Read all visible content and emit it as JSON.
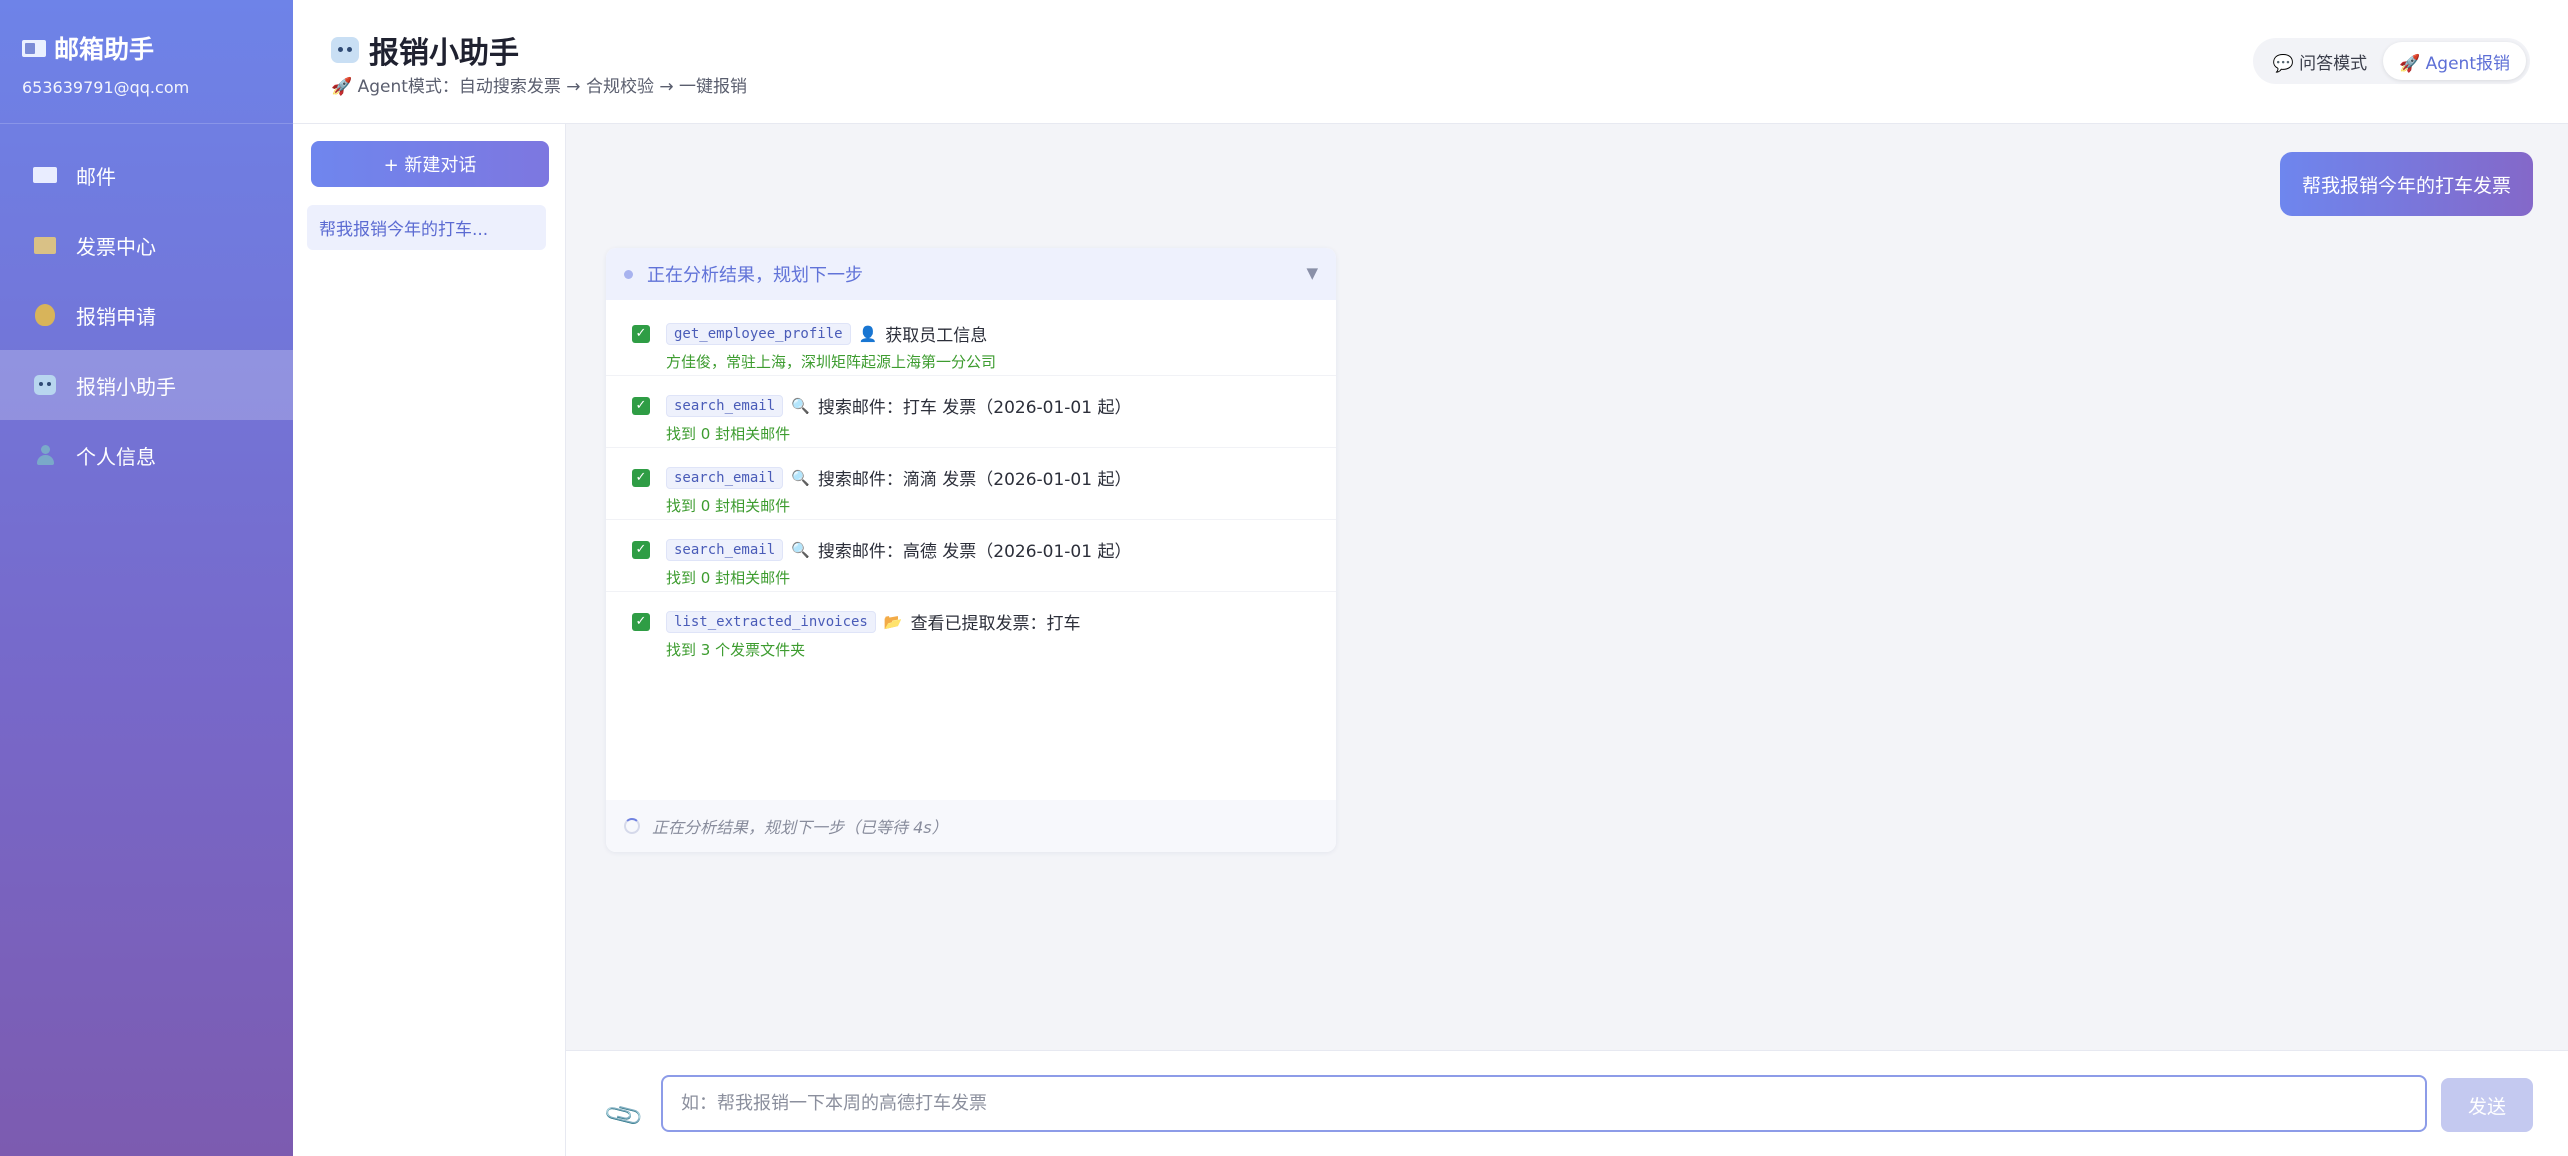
{
  "app": {
    "title": "邮箱助手",
    "email": "653639791@qq.com"
  },
  "sidebar": {
    "items": [
      {
        "label": "邮件",
        "icon": "mail-icon"
      },
      {
        "label": "发票中心",
        "icon": "folder-icon"
      },
      {
        "label": "报销申请",
        "icon": "money-bag-icon"
      },
      {
        "label": "报销小助手",
        "icon": "robot-icon",
        "active": true
      },
      {
        "label": "个人信息",
        "icon": "person-icon"
      }
    ]
  },
  "header": {
    "title": "报销小助手",
    "subtitle": "🚀 Agent模式：自动搜索发票 → 合规校验 → 一键报销",
    "modes": [
      {
        "label": "💬 问答模式",
        "active": false
      },
      {
        "label": "🚀 Agent报销",
        "active": true
      }
    ]
  },
  "conversations": {
    "new_label": "+ 新建对话",
    "items": [
      {
        "label": "帮我报销今年的打车..."
      }
    ]
  },
  "chat": {
    "user_message": "帮我报销今年的打车发票",
    "agent": {
      "status": "正在分析结果，规划下一步",
      "steps": [
        {
          "tool": "get_employee_profile",
          "icon": "👤",
          "desc": "获取员工信息",
          "result": "方佳俊，常驻上海，深圳矩阵起源上海第一分公司"
        },
        {
          "tool": "search_email",
          "icon": "🔍",
          "desc": "搜索邮件：打车 发票（2026-01-01 起）",
          "result": "找到 0 封相关邮件"
        },
        {
          "tool": "search_email",
          "icon": "🔍",
          "desc": "搜索邮件：滴滴 发票（2026-01-01 起）",
          "result": "找到 0 封相关邮件"
        },
        {
          "tool": "search_email",
          "icon": "🔍",
          "desc": "搜索邮件：高德 发票（2026-01-01 起）",
          "result": "找到 0 封相关邮件"
        },
        {
          "tool": "list_extracted_invoices",
          "icon": "📂",
          "desc": "查看已提取发票：打车",
          "result": "找到 3 个发票文件夹"
        }
      ],
      "footer": "正在分析结果，规划下一步（已等待 4s）"
    }
  },
  "input": {
    "placeholder": "如：帮我报销一下本周的高德打车发票",
    "send_label": "发送"
  },
  "colors": {
    "accent": "#6e83e8",
    "success": "#2f9d45",
    "result_text": "#3d9c2f"
  }
}
